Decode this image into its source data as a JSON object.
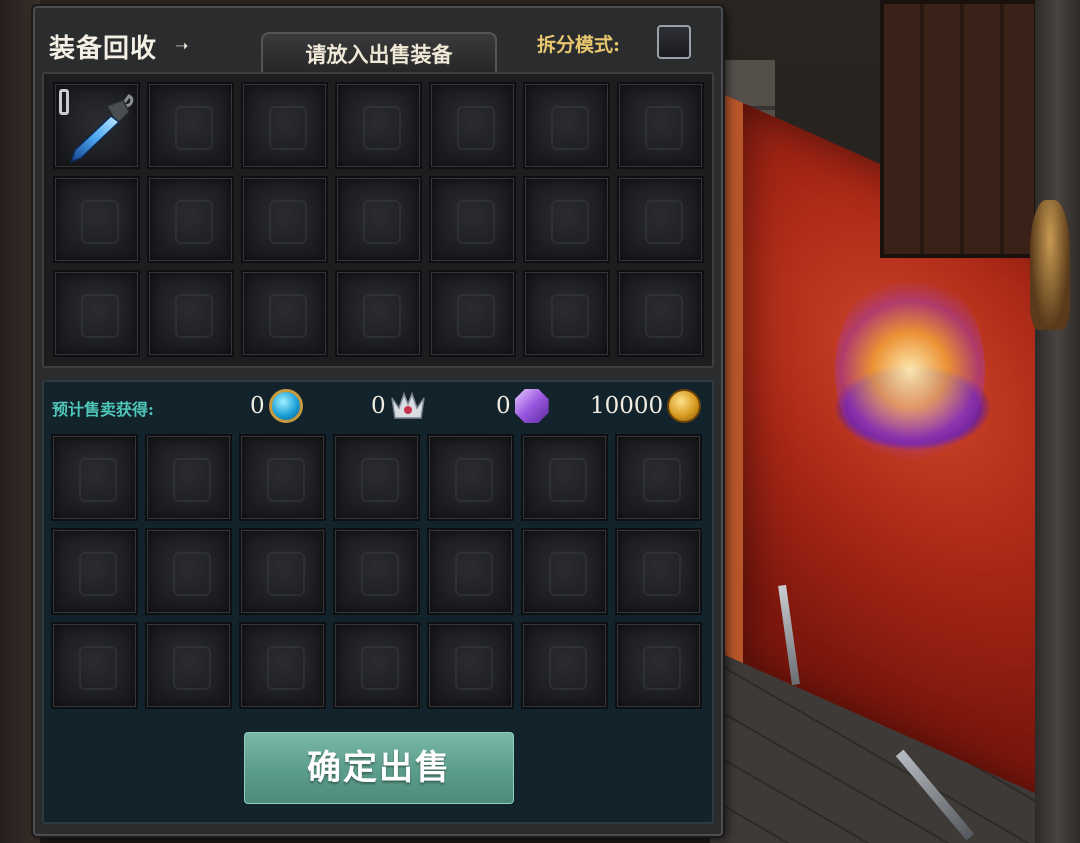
{
  "panel": {
    "title": "装备回收",
    "tab_label": "请放入出售装备",
    "split_mode_label": "拆分模式:",
    "split_mode_checked": false
  },
  "sell_slots": {
    "rows": 3,
    "cols": 7,
    "items": [
      {
        "slot": 0,
        "icon": "dagger-icon",
        "locked": true
      }
    ]
  },
  "estimate": {
    "label": "预计售卖获得:",
    "rewards": [
      {
        "value": "0",
        "icon": "blue-coin-icon"
      },
      {
        "value": "0",
        "icon": "silver-crown-icon"
      },
      {
        "value": "0",
        "icon": "purple-gem-icon"
      },
      {
        "value": "10000",
        "icon": "gold-coin-icon"
      }
    ]
  },
  "result_slots": {
    "rows": 3,
    "cols": 7
  },
  "confirm_button": {
    "label": "确定出售"
  },
  "colors": {
    "accent_teal": "#4fc7b8",
    "button_green": "#5c9c8b",
    "split_label_gold": "#e8c76e"
  }
}
